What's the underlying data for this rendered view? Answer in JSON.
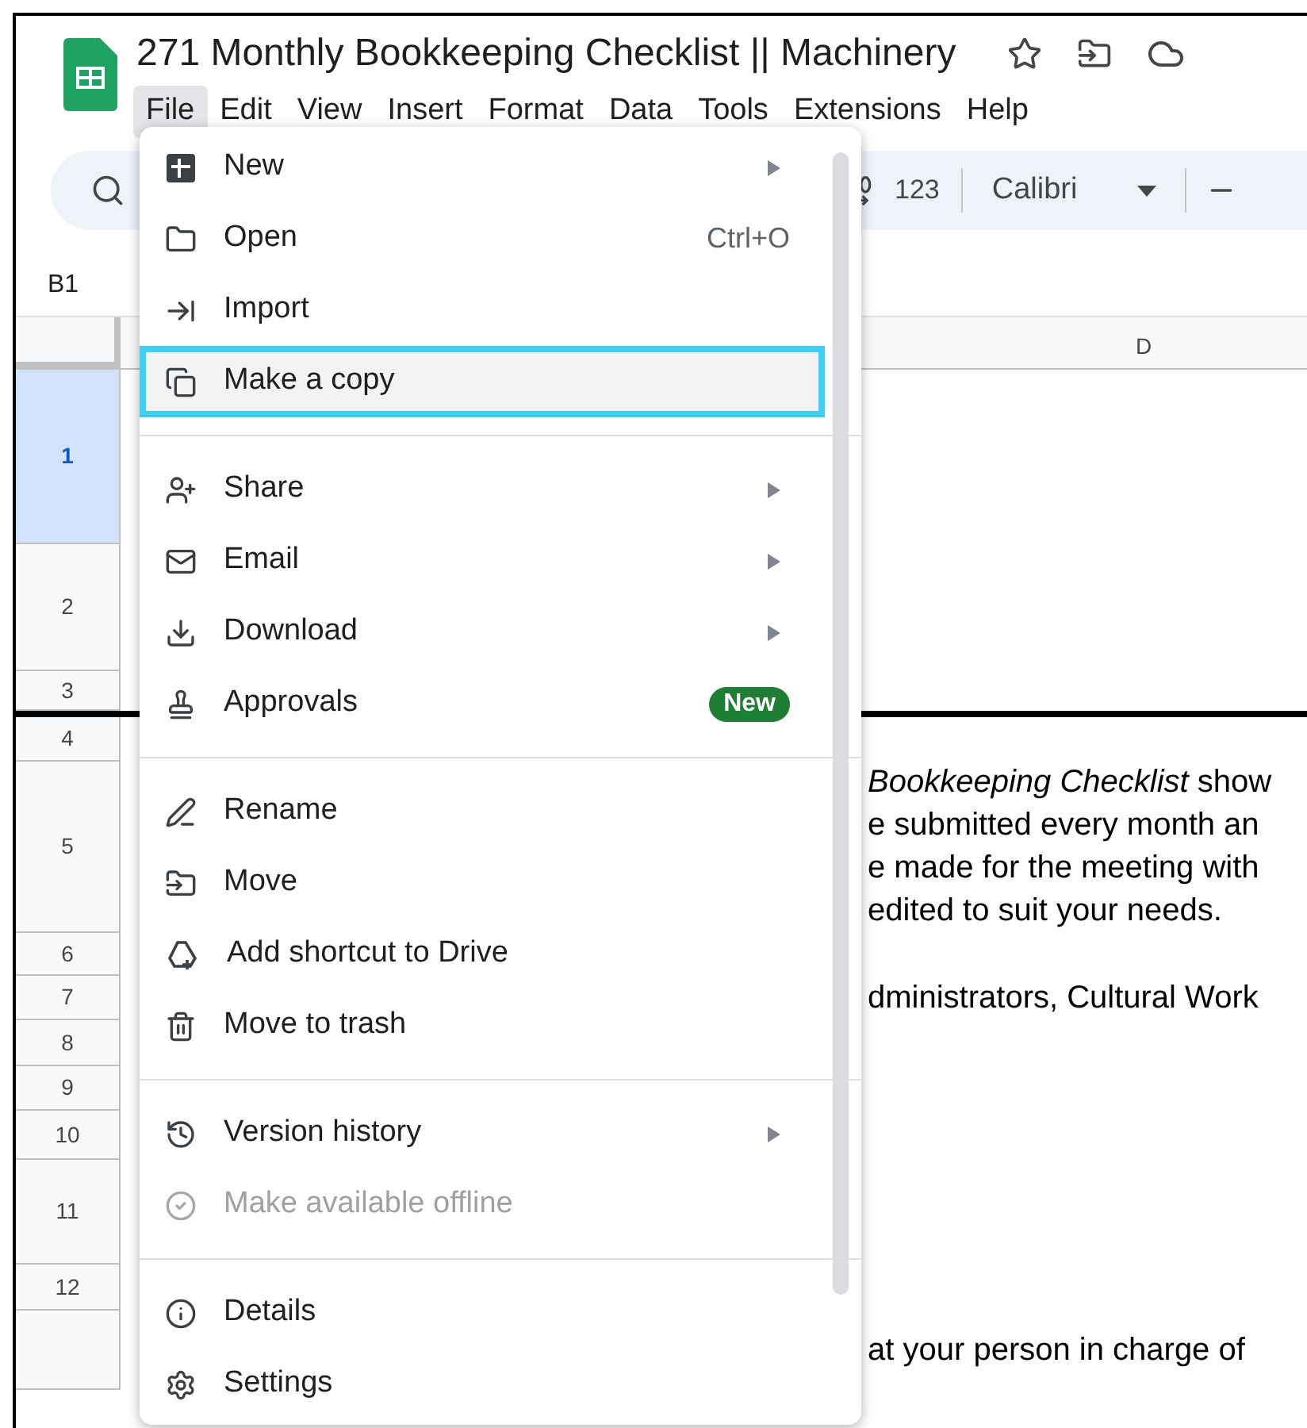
{
  "document": {
    "title": "271 Monthly Bookkeeping Checklist || Machinery"
  },
  "menubar": [
    {
      "label": "File",
      "selected": true
    },
    {
      "label": "Edit",
      "selected": false
    },
    {
      "label": "View",
      "selected": false
    },
    {
      "label": "Insert",
      "selected": false
    },
    {
      "label": "Format",
      "selected": false
    },
    {
      "label": "Data",
      "selected": false
    },
    {
      "label": "Tools",
      "selected": false
    },
    {
      "label": "Extensions",
      "selected": false
    },
    {
      "label": "Help",
      "selected": false
    }
  ],
  "toolbar": {
    "number_format": "123",
    "font": "Calibri"
  },
  "name_box": "B1",
  "column_header": "D",
  "rows": [
    {
      "number": "1",
      "selected": true,
      "thick_bottom": false,
      "lines": []
    },
    {
      "number": "2",
      "selected": false,
      "thick_bottom": false,
      "lines": []
    },
    {
      "number": "3",
      "selected": false,
      "thick_bottom": true,
      "lines": []
    },
    {
      "number": "4",
      "selected": false,
      "thick_bottom": false,
      "lines": []
    },
    {
      "number": "5",
      "selected": false,
      "thick_bottom": false,
      "lines": [
        "*Bookkeeping Checklist* show",
        "e submitted every month an",
        "e made for the meeting with",
        "edited to suit your needs."
      ]
    },
    {
      "number": "6",
      "selected": false,
      "thick_bottom": false,
      "lines": []
    },
    {
      "number": "7",
      "selected": false,
      "thick_bottom": false,
      "lines": [
        "dministrators, Cultural Work"
      ]
    },
    {
      "number": "8",
      "selected": false,
      "thick_bottom": false,
      "lines": []
    },
    {
      "number": "9",
      "selected": false,
      "thick_bottom": false,
      "lines": []
    },
    {
      "number": "10",
      "selected": false,
      "thick_bottom": false,
      "lines": []
    },
    {
      "number": "11",
      "selected": false,
      "thick_bottom": false,
      "lines": []
    },
    {
      "number": "12",
      "selected": false,
      "thick_bottom": false,
      "lines": []
    },
    {
      "selected": false,
      "thick_bottom": false,
      "lines": [
        "at your person in charge of"
      ]
    }
  ],
  "file_menu": [
    [
      {
        "label": "New",
        "has_submenu": true,
        "disabled": false,
        "selected": false
      },
      {
        "label": "Open",
        "shortcut": "Ctrl+O",
        "has_submenu": false,
        "disabled": false,
        "selected": false
      },
      {
        "label": "Import",
        "has_submenu": false,
        "disabled": false,
        "selected": false
      },
      {
        "label": "Make a copy",
        "has_submenu": false,
        "disabled": false,
        "selected": true
      }
    ],
    [
      {
        "label": "Share",
        "has_submenu": true,
        "disabled": false,
        "selected": false
      },
      {
        "label": "Email",
        "has_submenu": true,
        "disabled": false,
        "selected": false
      },
      {
        "label": "Download",
        "has_submenu": true,
        "disabled": false,
        "selected": false
      },
      {
        "label": "Approvals",
        "badge": "New",
        "has_submenu": false,
        "disabled": false,
        "selected": false
      }
    ],
    [
      {
        "label": "Rename",
        "has_submenu": false,
        "disabled": false,
        "selected": false
      },
      {
        "label": "Move",
        "has_submenu": false,
        "disabled": false,
        "selected": false
      },
      {
        "label": "Add shortcut to Drive",
        "has_submenu": false,
        "disabled": false,
        "selected": false
      },
      {
        "label": "Move to trash",
        "has_submenu": false,
        "disabled": false,
        "selected": false
      }
    ],
    [
      {
        "label": "Version history",
        "has_submenu": true,
        "disabled": false,
        "selected": false
      },
      {
        "label": "Make available offline",
        "has_submenu": false,
        "disabled": true,
        "selected": false
      }
    ],
    [
      {
        "label": "Details",
        "has_submenu": false,
        "disabled": false,
        "selected": false
      },
      {
        "label": "Settings",
        "has_submenu": false,
        "disabled": false,
        "selected": false
      }
    ]
  ]
}
